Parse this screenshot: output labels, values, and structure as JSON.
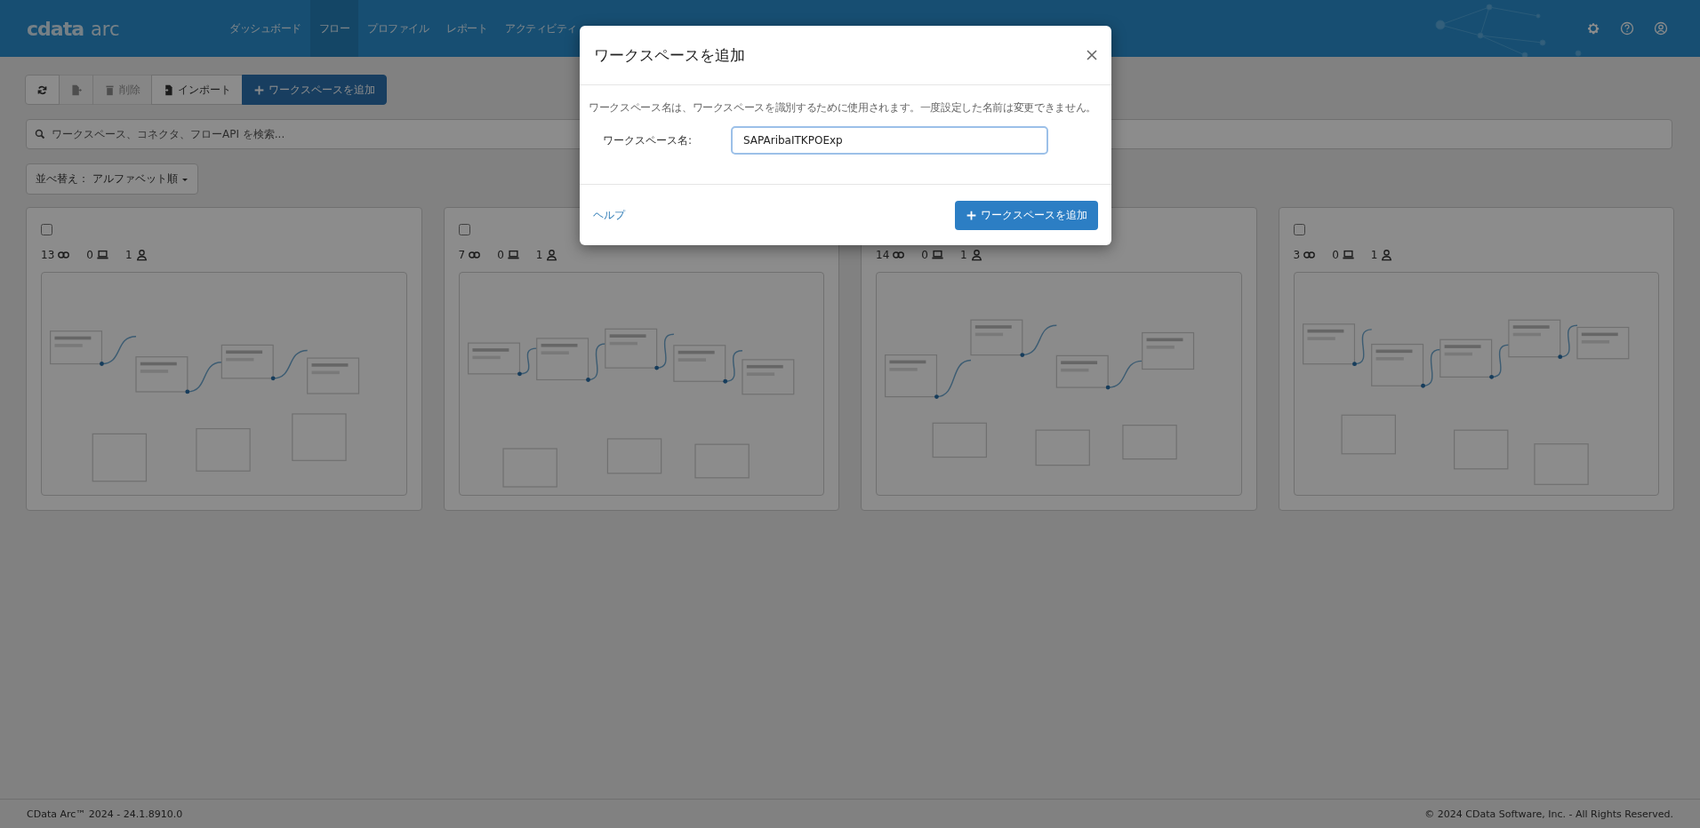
{
  "header": {
    "logo": {
      "brand": "cdata",
      "product": "arc"
    },
    "nav": [
      {
        "label": "ダッシュボード",
        "selected": false
      },
      {
        "label": "フロー",
        "selected": true
      },
      {
        "label": "プロファイル",
        "selected": false
      },
      {
        "label": "レポート",
        "selected": false
      },
      {
        "label": "アクティビティ",
        "selected": false
      }
    ]
  },
  "toolbar": [
    {
      "kind": "refresh",
      "disabled": false
    },
    {
      "kind": "export",
      "disabled": true
    },
    {
      "kind": "delete",
      "label": "削除",
      "disabled": true
    },
    {
      "kind": "import",
      "label": "インポート",
      "disabled": false
    },
    {
      "kind": "add",
      "label": "ワークスペースを追加",
      "disabled": false
    }
  ],
  "search": {
    "placeholder": "ワークスペース、コネクタ、フローAPI を検索..."
  },
  "sort": {
    "label": "並べ替え： アルファベット順"
  },
  "cards": [
    {
      "checked": false,
      "connections": "13",
      "ports": "0",
      "users": "1"
    },
    {
      "checked": false,
      "connections": "7",
      "ports": "0",
      "users": "1"
    },
    {
      "connections": "14",
      "ports": "0",
      "users": "1"
    },
    {
      "checked": false,
      "connections": "3",
      "ports": "0",
      "users": "1"
    }
  ],
  "modal": {
    "title": "ワークスペースを追加",
    "description": "ワークスペース名は、ワークスペースを識別するために使用されます。一度設定した名前は変更できません。",
    "field_label": "ワークスペース名:",
    "field_value": "SAPAribaITKPOExp",
    "help_link": "ヘルプ",
    "submit": "ワークスペースを追加"
  },
  "footer": {
    "left": "CData Arc™ 2024 - 24.1.8910.0",
    "right": "© 2024 CData Software, Inc. - All Rights Reserved."
  }
}
